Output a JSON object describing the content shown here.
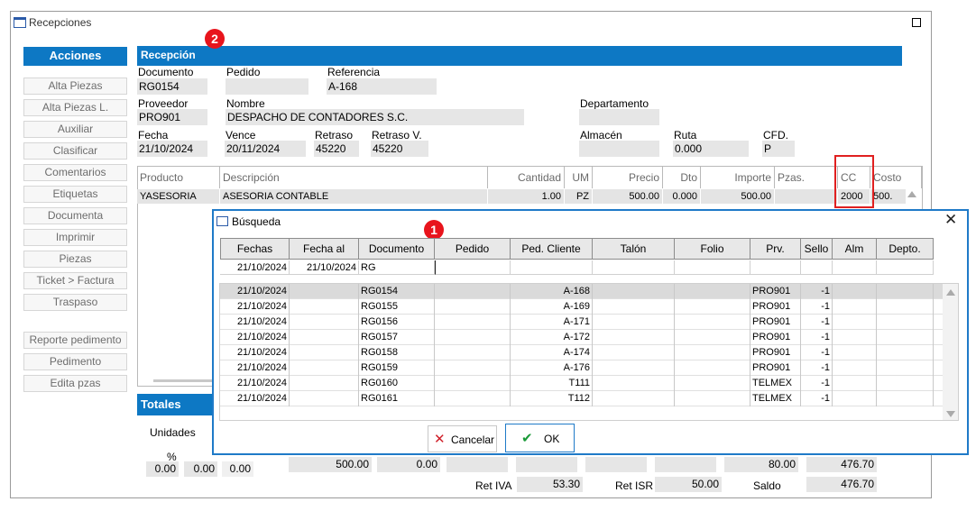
{
  "window": {
    "title": "Recepciones"
  },
  "sidebar": {
    "header": "Acciones",
    "buttons": [
      "Alta Piezas",
      "Alta Piezas L.",
      "Auxiliar",
      "Clasificar",
      "Comentarios",
      "Etiquetas",
      "Documenta",
      "Imprimir",
      "Piezas",
      "Ticket > Factura",
      "Traspaso"
    ],
    "buttons2": [
      "Reporte pedimento",
      "Pedimento",
      "Edita pzas"
    ]
  },
  "badges": {
    "b1": "1",
    "b2": "2"
  },
  "recepcion": {
    "header": "Recepción",
    "documento_label": "Documento",
    "documento": "RG0154",
    "pedido_label": "Pedido",
    "pedido": "",
    "referencia_label": "Referencia",
    "referencia": "A-168",
    "proveedor_label": "Proveedor",
    "proveedor": "PRO901",
    "nombre_label": "Nombre",
    "nombre": "DESPACHO DE CONTADORES S.C.",
    "departamento_label": "Departamento",
    "departamento": "",
    "fecha_label": "Fecha",
    "fecha": "21/10/2024",
    "vence_label": "Vence",
    "vence": "20/11/2024",
    "retraso_label": "Retraso",
    "retraso": "45220",
    "retraso_v_label": "Retraso V.",
    "retraso_v": "45220",
    "almacen_label": "Almacén",
    "almacen": "",
    "ruta_label": "Ruta",
    "ruta": "0.000",
    "cfd_label": "CFD.",
    "cfd": "P"
  },
  "items_grid": {
    "headers": [
      "Producto",
      "Descripción",
      "Cantidad",
      "UM",
      "Precio",
      "Dto",
      "Importe",
      "Pzas.",
      "CC",
      "Costo"
    ],
    "row": [
      "YASESORIA",
      "ASESORIA CONTABLE",
      "1.00",
      "PZ",
      "500.00",
      "0.000",
      "500.00",
      "",
      "2000",
      "500."
    ]
  },
  "totales": {
    "header": "Totales",
    "unidades_label": "Unidades",
    "pct_label": "%",
    "pct_values": [
      "0.00",
      "0.00",
      "0.00"
    ],
    "row_values": [
      "500.00",
      "0.00",
      "80.00",
      "476.70"
    ],
    "ret_iva_label": "Ret IVA",
    "ret_iva": "53.30",
    "ret_isr_label": "Ret ISR",
    "ret_isr": "50.00",
    "saldo_label": "Saldo",
    "saldo": "476.70"
  },
  "busqueda": {
    "title": "Búsqueda",
    "headers": [
      "Fechas",
      "Fecha al",
      "Documento",
      "Pedido",
      "Ped. Cliente",
      "Talón",
      "Folio",
      "Prv.",
      "Sello",
      "Alm",
      "Depto."
    ],
    "filters": [
      "21/10/2024",
      "21/10/2024",
      "RG",
      "",
      "",
      "",
      "",
      "",
      "",
      "",
      ""
    ],
    "rows": [
      [
        "21/10/2024",
        "",
        "RG0154",
        "",
        "A-168",
        "",
        "",
        "PRO901",
        "-1",
        "",
        ""
      ],
      [
        "21/10/2024",
        "",
        "RG0155",
        "",
        "A-169",
        "",
        "",
        "PRO901",
        "-1",
        "",
        ""
      ],
      [
        "21/10/2024",
        "",
        "RG0156",
        "",
        "A-171",
        "",
        "",
        "PRO901",
        "-1",
        "",
        ""
      ],
      [
        "21/10/2024",
        "",
        "RG0157",
        "",
        "A-172",
        "",
        "",
        "PRO901",
        "-1",
        "",
        ""
      ],
      [
        "21/10/2024",
        "",
        "RG0158",
        "",
        "A-174",
        "",
        "",
        "PRO901",
        "-1",
        "",
        ""
      ],
      [
        "21/10/2024",
        "",
        "RG0159",
        "",
        "A-176",
        "",
        "",
        "PRO901",
        "-1",
        "",
        ""
      ],
      [
        "21/10/2024",
        "",
        "RG0160",
        "",
        "T111",
        "",
        "",
        "TELMEX",
        "-1",
        "",
        ""
      ],
      [
        "21/10/2024",
        "",
        "RG0161",
        "",
        "T112",
        "",
        "",
        "TELMEX",
        "-1",
        "",
        ""
      ]
    ],
    "cancel_label": "Cancelar",
    "ok_label": "OK"
  },
  "colors": {
    "accent": "#0d78c4",
    "badge": "#e8141c",
    "dialog_border": "#1f7ac8",
    "highlight": "#e02020"
  }
}
